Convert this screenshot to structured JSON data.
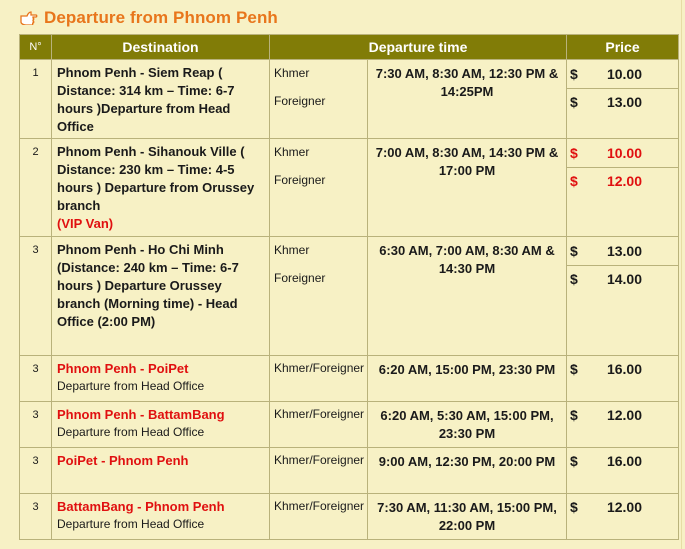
{
  "header": {
    "title": "Departure from Phnom Penh",
    "icon": "pointing-hand-icon"
  },
  "table": {
    "columns": [
      "N°",
      "Destination",
      "Departure time",
      "Price"
    ],
    "rows": [
      {
        "no": "1",
        "dest": "Phnom Penh - Siem Reap ( Distance: 314 km – Time: 6-7 hours )Departure from Head Office",
        "dest_red": "",
        "sub": "",
        "types": [
          "Khmer",
          "Foreigner"
        ],
        "time": "7:30 AM, 8:30 AM, 12:30 PM & 14:25PM",
        "prices": [
          {
            "currency": "$",
            "amount": "10.00",
            "color": "#1a1a1a"
          },
          {
            "currency": "$",
            "amount": "13.00",
            "color": "#1a1a1a"
          }
        ]
      },
      {
        "no": "2",
        "dest": "Phnom Penh - Sihanouk Ville ( Distance: 230 km – Time: 4-5 hours ) Departure from Orussey branch",
        "dest_red": "(VIP Van)",
        "sub": "",
        "types": [
          "Khmer",
          "Foreigner"
        ],
        "time": "7:00 AM, 8:30 AM, 14:30 PM & 17:00 PM",
        "prices": [
          {
            "currency": "$",
            "amount": "10.00",
            "color": "#e01010"
          },
          {
            "currency": "$",
            "amount": "12.00",
            "color": "#e01010"
          }
        ]
      },
      {
        "no": "3",
        "dest": "Phnom Penh - Ho Chi Minh (Distance: 240 km – Time: 6-7 hours ) Departure Orussey branch (Morning time) - Head Office (2:00 PM)",
        "dest_red": "",
        "sub": "",
        "types": [
          "Khmer",
          "Foreigner"
        ],
        "time": "6:30 AM, 7:00 AM, 8:30 AM & 14:30 PM",
        "prices": [
          {
            "currency": "$",
            "amount": "13.00",
            "color": "#1a1a1a"
          },
          {
            "currency": "$",
            "amount": "14.00",
            "color": "#1a1a1a"
          }
        ]
      },
      {
        "no": "3",
        "dest": "",
        "dest_red": "Phnom Penh - PoiPet",
        "sub": "Departure from Head Office",
        "types": [
          "Khmer/Foreigner"
        ],
        "time": "6:20 AM, 15:00 PM, 23:30 PM",
        "prices": [
          {
            "currency": "$",
            "amount": "16.00",
            "color": "#1a1a1a"
          }
        ]
      },
      {
        "no": "3",
        "dest": "",
        "dest_red": "Phnom Penh - BattamBang",
        "sub": "Departure from Head Office",
        "types": [
          "Khmer/Foreigner"
        ],
        "time": "6:20 AM, 5:30 AM, 15:00 PM, 23:30 PM",
        "prices": [
          {
            "currency": "$",
            "amount": "12.00",
            "color": "#1a1a1a"
          }
        ]
      },
      {
        "no": "3",
        "dest": "",
        "dest_red": "PoiPet - Phnom Penh",
        "sub": "",
        "types": [
          "Khmer/Foreigner"
        ],
        "time": "9:00 AM, 12:30 PM, 20:00 PM",
        "prices": [
          {
            "currency": "$",
            "amount": "16.00",
            "color": "#1a1a1a"
          }
        ]
      },
      {
        "no": "3",
        "dest": "",
        "dest_red": "BattamBang - Phnom Penh",
        "sub": "Departure from Head Office",
        "types": [
          "Khmer/Foreigner"
        ],
        "time": "7:30 AM, 11:30 AM, 15:00 PM, 22:00 PM",
        "prices": [
          {
            "currency": "$",
            "amount": "12.00",
            "color": "#1a1a1a"
          }
        ]
      }
    ]
  }
}
